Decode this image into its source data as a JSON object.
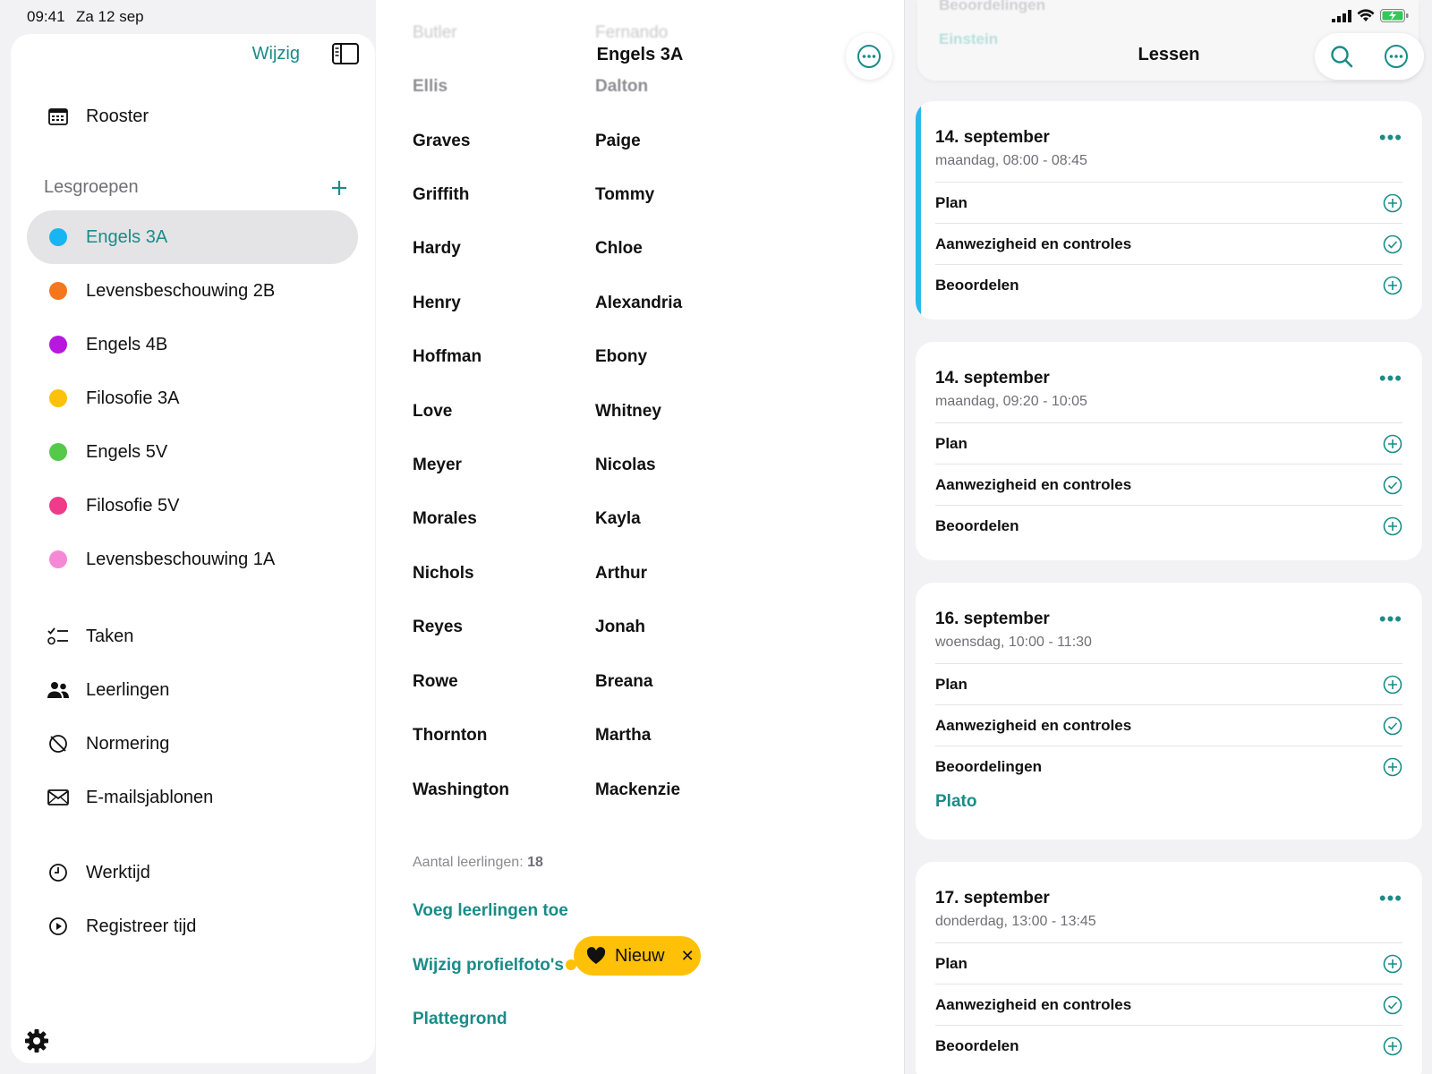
{
  "status": {
    "time": "09:41",
    "date": "Za 12 sep"
  },
  "sidebar": {
    "edit_label": "Wijzig",
    "schedule_label": "Rooster",
    "groups_heading": "Lesgroepen",
    "groups": [
      {
        "label": "Engels 3A",
        "color": "#17b5f2"
      },
      {
        "label": "Levensbeschouwing 2B",
        "color": "#f5761d"
      },
      {
        "label": "Engels 4B",
        "color": "#b817e0"
      },
      {
        "label": "Filosofie 3A",
        "color": "#fcc10a"
      },
      {
        "label": "Engels 5V",
        "color": "#54c94a"
      },
      {
        "label": "Filosofie 5V",
        "color": "#f03a8a"
      },
      {
        "label": "Levensbeschouwing 1A",
        "color": "#f689d6"
      }
    ],
    "tools": [
      {
        "label": "Taken",
        "icon": "checklist-icon"
      },
      {
        "label": "Leerlingen",
        "icon": "people-icon"
      },
      {
        "label": "Normering",
        "icon": "grading-icon"
      },
      {
        "label": "E-mailsjablonen",
        "icon": "envelope-icon"
      }
    ],
    "time_items": [
      {
        "label": "Werktijd",
        "icon": "clock-icon"
      },
      {
        "label": "Registreer tijd",
        "icon": "play-circle-icon"
      }
    ]
  },
  "middle": {
    "title": "Engels 3A",
    "faded": [
      {
        "last": "Butler",
        "first": "Fernando"
      },
      {
        "last": "Ellis",
        "first": "Dalton"
      }
    ],
    "students": [
      {
        "last": "Graves",
        "first": "Paige"
      },
      {
        "last": "Griffith",
        "first": "Tommy"
      },
      {
        "last": "Hardy",
        "first": "Chloe"
      },
      {
        "last": "Henry",
        "first": "Alexandria"
      },
      {
        "last": "Hoffman",
        "first": "Ebony"
      },
      {
        "last": "Love",
        "first": "Whitney"
      },
      {
        "last": "Meyer",
        "first": "Nicolas"
      },
      {
        "last": "Morales",
        "first": "Kayla"
      },
      {
        "last": "Nichols",
        "first": "Arthur"
      },
      {
        "last": "Reyes",
        "first": "Jonah"
      },
      {
        "last": "Rowe",
        "first": "Breana"
      },
      {
        "last": "Thornton",
        "first": "Martha"
      },
      {
        "last": "Washington",
        "first": "Mackenzie"
      }
    ],
    "count_label": "Aantal leerlingen:",
    "count_value": "18",
    "add_students": "Voeg leerlingen toe",
    "edit_photos": "Wijzig profielfoto's",
    "floor_plan": "Plattegrond",
    "new_badge": "Nieuw"
  },
  "right": {
    "title": "Lessen",
    "faded_top": [
      "Beoordelingen",
      "Einstein"
    ],
    "lessons": [
      {
        "date": "14. september",
        "time": "maandag, 08:00 - 08:45",
        "rows": [
          "Plan",
          "Aanwezigheid en controles",
          "Beoordelen"
        ]
      },
      {
        "date": "14. september",
        "time": "maandag, 09:20 - 10:05",
        "rows": [
          "Plan",
          "Aanwezigheid en controles",
          "Beoordelen"
        ]
      },
      {
        "date": "16. september",
        "time": "woensdag, 10:00 - 11:30",
        "rows": [
          "Plan",
          "Aanwezigheid en controles",
          "Beoordelingen"
        ],
        "extra": "Plato"
      },
      {
        "date": "17. september",
        "time": "donderdag, 13:00 - 13:45",
        "rows": [
          "Plan",
          "Aanwezigheid en controles",
          "Beoordelen"
        ]
      }
    ]
  }
}
